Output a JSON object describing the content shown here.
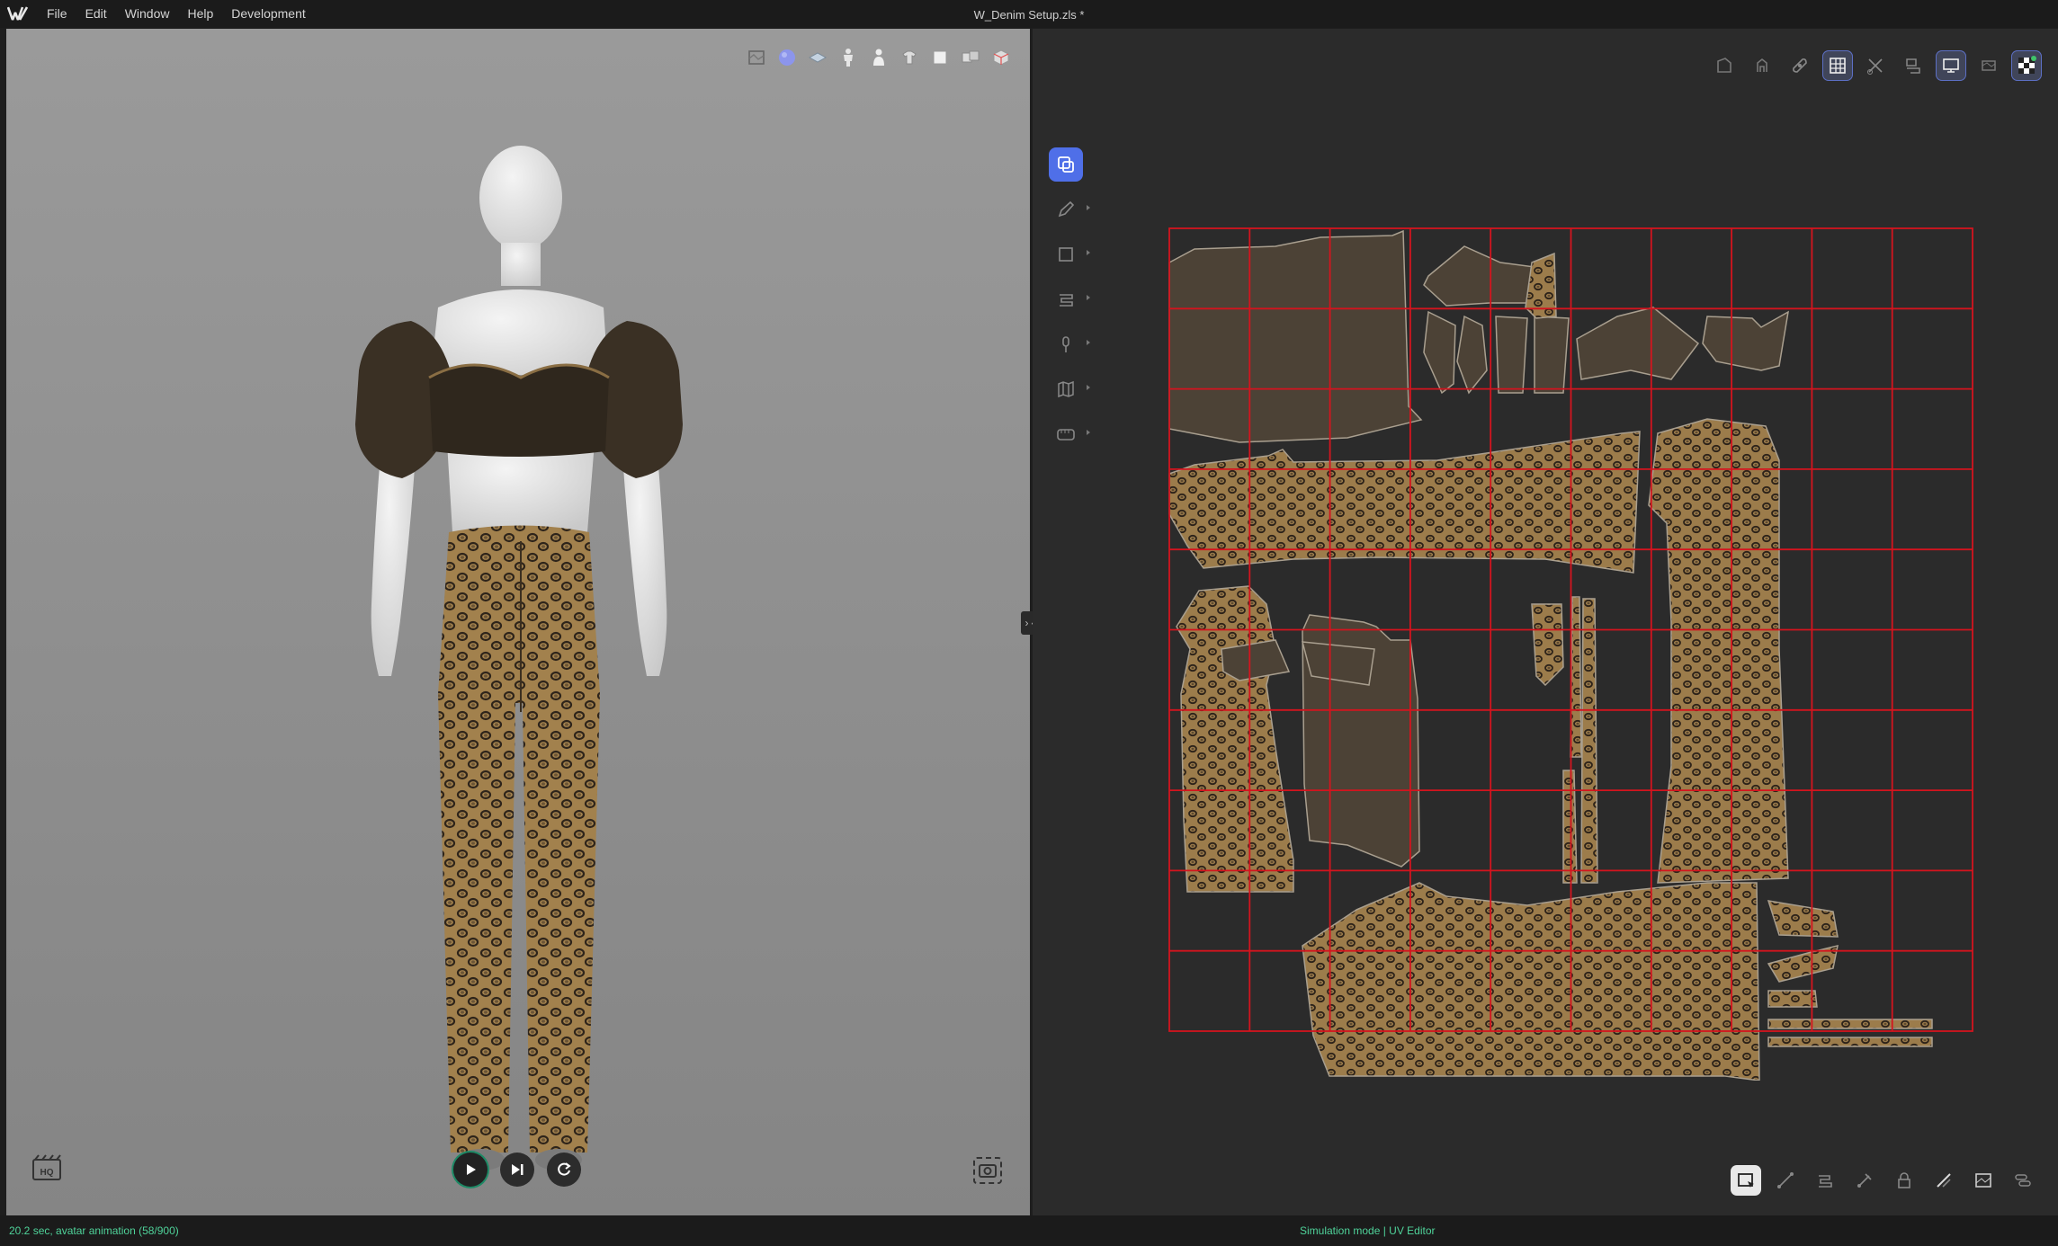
{
  "menubar": {
    "items": [
      "File",
      "Edit",
      "Window",
      "Help",
      "Development"
    ],
    "window_title": "W_Denim Setup.zls *"
  },
  "viewport": {
    "toolbar_icons": [
      "texture-view-icon",
      "shaded-sphere-icon",
      "fabric-layer-icon",
      "avatar-icon",
      "avatar-silhouette-icon",
      "garment-icon",
      "box-icon",
      "pattern-icon",
      "cube-icon"
    ],
    "hq_label": "HQ",
    "playback": [
      "play-icon",
      "step-forward-icon",
      "reset-icon"
    ]
  },
  "uv_editor": {
    "top_icons": [
      "pattern-2d-icon",
      "avatar-2d-icon",
      "sticker-icon",
      "uv-grid-icon",
      "cut-icon",
      "uv-layout-icon",
      "selected-display-icon",
      "texture-swatch-icon",
      "checker-icon"
    ],
    "side_tools": [
      "transform-uv-icon",
      "pen-icon",
      "rectangle-icon",
      "sewing-icon",
      "pin-icon",
      "map-icon",
      "tape-measure-icon"
    ],
    "bottom_icons": [
      "select-uv-icon",
      "edit-point-icon",
      "arrange-icon",
      "pin-uv-icon",
      "lock-icon",
      "seam-icon",
      "image-icon",
      "settings-toggle-icon"
    ],
    "grid_color": "#d4141e",
    "fabric_solid": "#4b4135",
    "fabric_leopard": "#9a7a4a"
  },
  "status": {
    "left": "20.2 sec, avatar animation (58/900)",
    "center": "Simulation mode | UV Editor"
  }
}
